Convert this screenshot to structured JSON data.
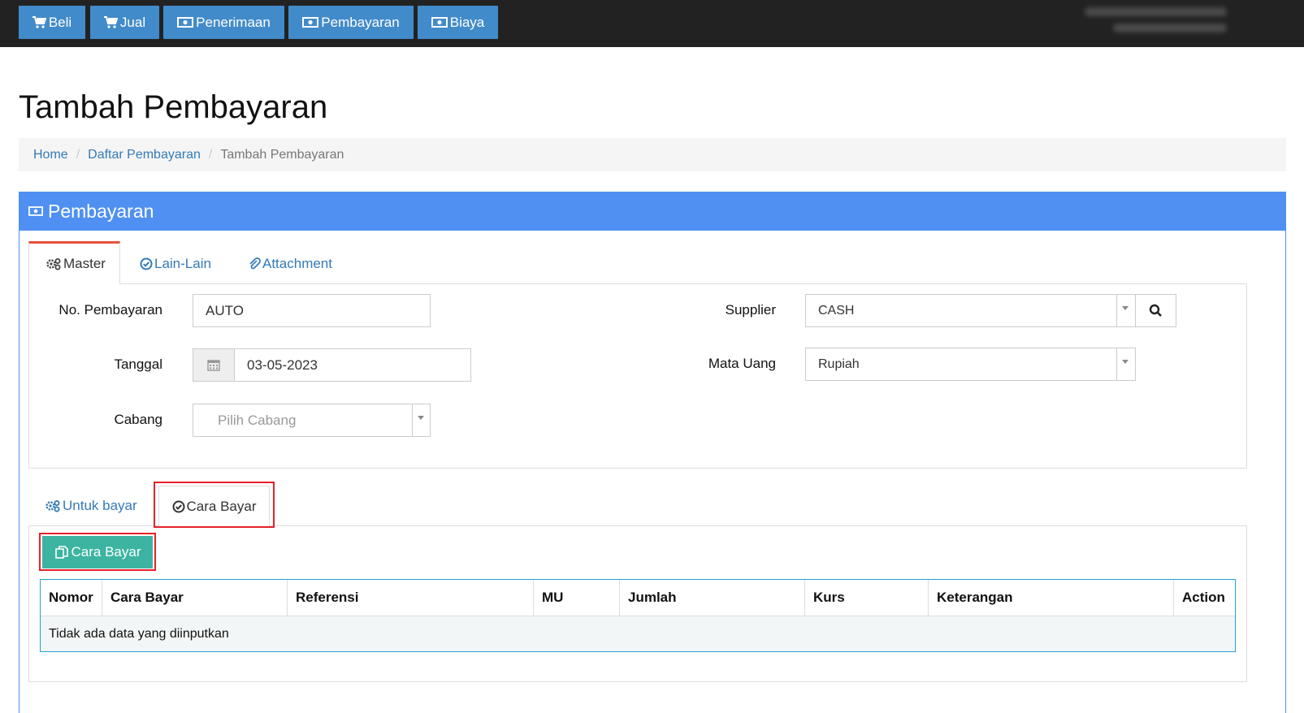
{
  "topnav": {
    "buttons": [
      {
        "label": "Beli",
        "icon": "cart-icon"
      },
      {
        "label": "Jual",
        "icon": "cart-icon"
      },
      {
        "label": "Penerimaan",
        "icon": "money-icon"
      },
      {
        "label": "Pembayaran",
        "icon": "money-icon"
      },
      {
        "label": "Biaya",
        "icon": "money-icon"
      }
    ]
  },
  "page": {
    "title": "Tambah Pembayaran"
  },
  "breadcrumb": {
    "home": "Home",
    "list": "Daftar Pembayaran",
    "current": "Tambah Pembayaran",
    "separator": "/"
  },
  "panel": {
    "title": "Pembayaran"
  },
  "tabs": {
    "master": "Master",
    "lain": "Lain-Lain",
    "attachment": "Attachment"
  },
  "form": {
    "no_label": "No. Pembayaran",
    "no_value": "AUTO",
    "tanggal_label": "Tanggal",
    "tanggal_value": "03-05-2023",
    "cabang_label": "Cabang",
    "cabang_placeholder": "Pilih Cabang",
    "supplier_label": "Supplier",
    "supplier_value": "CASH",
    "mata_uang_label": "Mata Uang",
    "mata_uang_value": "Rupiah"
  },
  "subtabs": {
    "untuk_bayar": "Untuk bayar",
    "cara_bayar": "Cara Bayar"
  },
  "add_button": {
    "label": "Cara Bayar"
  },
  "table": {
    "headers": [
      "Nomor",
      "Cara Bayar",
      "Referensi",
      "MU",
      "Jumlah",
      "Kurs",
      "Keterangan",
      "Action"
    ],
    "empty_text": "Tidak ada data yang diinputkan"
  },
  "colors": {
    "primary": "#428bca",
    "panel": "#4f90f2",
    "success": "#3cb4a1",
    "highlight": "#e8202a",
    "tab_active_border": "#e8503a"
  }
}
